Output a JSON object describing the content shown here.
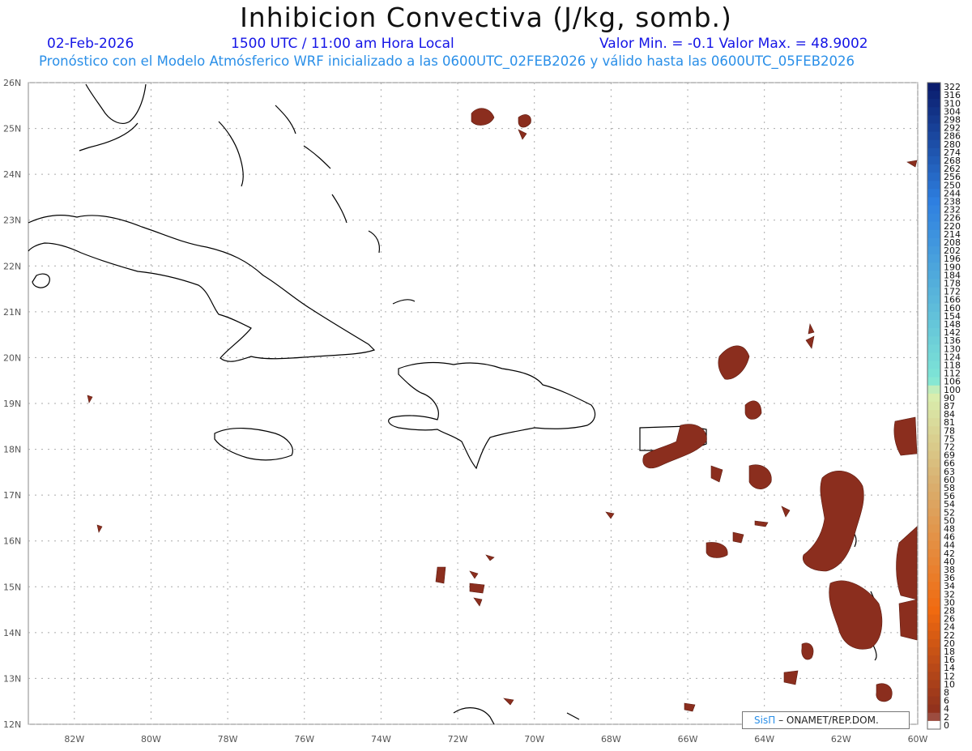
{
  "title": "Inhibicion Convectiva (J/kg, somb.)",
  "header": {
    "date": "02-Feb-2026",
    "time": "1500 UTC / 11:00 am Hora Local",
    "values": "Valor Min. = -0.1  Valor Max. = 48.9002",
    "model_line": "Pronóstico con el Modelo Atmósferico WRF inicializado a las 0600UTC_02FEB2026 y válido hasta las  0600UTC_05FEB2026"
  },
  "map": {
    "lon_labels": [
      "82W",
      "80W",
      "78W",
      "76W",
      "74W",
      "72W",
      "70W",
      "68W",
      "66W",
      "64W",
      "62W",
      "60W"
    ],
    "lat_labels": [
      "26N",
      "25N",
      "24N",
      "23N",
      "22N",
      "21N",
      "20N",
      "19N",
      "18N",
      "17N",
      "16N",
      "15N",
      "14N",
      "13N",
      "12N"
    ],
    "lon_range": [
      -83.2,
      -60.0
    ],
    "lat_range": [
      12.0,
      26.0
    ],
    "field_color": "#8b2e1e",
    "coast_color": "#000000",
    "grid": "dotted"
  },
  "colorbar": {
    "labels": [
      "322",
      "316",
      "310",
      "304",
      "298",
      "292",
      "286",
      "280",
      "274",
      "268",
      "262",
      "256",
      "250",
      "244",
      "238",
      "232",
      "226",
      "220",
      "214",
      "208",
      "202",
      "196",
      "190",
      "184",
      "178",
      "172",
      "166",
      "160",
      "154",
      "148",
      "142",
      "136",
      "130",
      "124",
      "118",
      "112",
      "106",
      "100",
      "90",
      "87",
      "84",
      "81",
      "78",
      "75",
      "72",
      "69",
      "66",
      "63",
      "60",
      "58",
      "56",
      "54",
      "52",
      "50",
      "48",
      "46",
      "44",
      "42",
      "40",
      "38",
      "36",
      "34",
      "32",
      "30",
      "28",
      "26",
      "24",
      "22",
      "20",
      "18",
      "16",
      "14",
      "12",
      "10",
      "8",
      "6",
      "4",
      "2",
      "0"
    ],
    "colors": {
      "top": "#0b1d6e",
      "mid_blue": "#2e7fe0",
      "cyan": "#7fe6d6",
      "green_pale": "#d9f0b0",
      "tan": "#d9b070",
      "orange": "#f06a10",
      "brown": "#8b2e1e",
      "zero": "#ffffff"
    }
  },
  "credit": {
    "brand": "SisΠ",
    "text": "– ONAMET/REP.DOM."
  }
}
